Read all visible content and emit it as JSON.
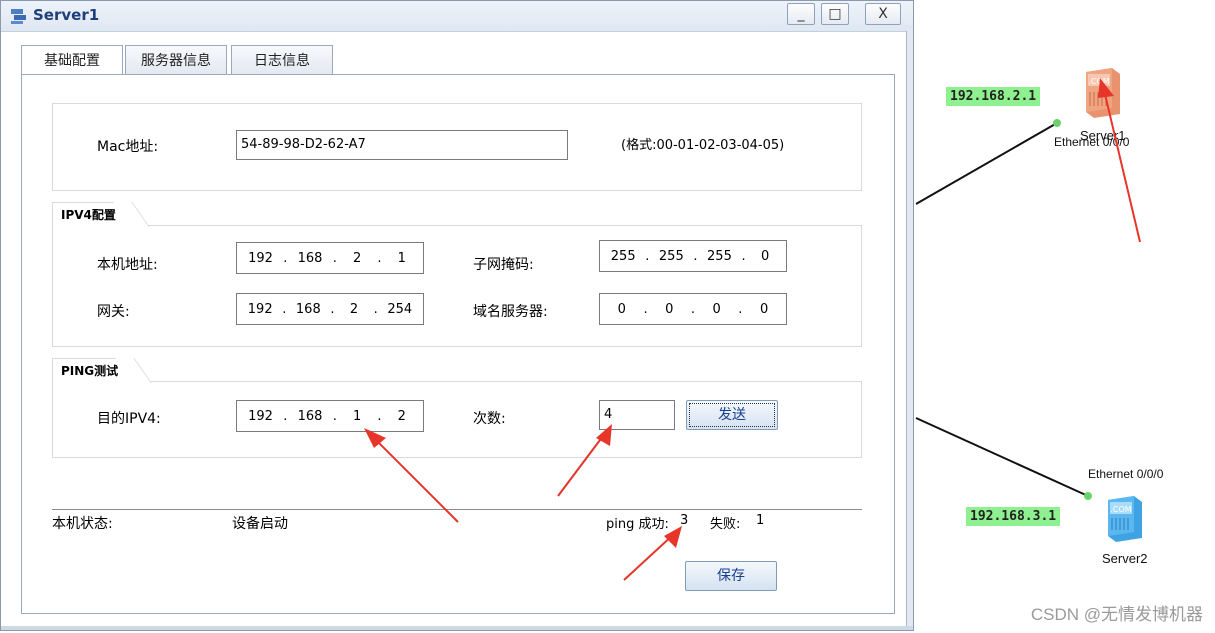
{
  "window": {
    "title": "Server1",
    "minimize": "_",
    "maximize": "□",
    "close": "X"
  },
  "tabs": [
    {
      "label": "基础配置"
    },
    {
      "label": "服务器信息"
    },
    {
      "label": "日志信息"
    }
  ],
  "mac": {
    "label": "Mac地址:",
    "value": "54-89-98-D2-62-A7",
    "hint": "(格式:00-01-02-03-04-05)"
  },
  "ipv4": {
    "section_title": "IPV4配置",
    "local_address_label": "本机地址:",
    "local_address": [
      "192",
      "168",
      "2",
      "1"
    ],
    "subnet_mask_label": "子网掩码:",
    "subnet_mask": [
      "255",
      "255",
      "255",
      "0"
    ],
    "gateway_label": "网关:",
    "gateway": [
      "192",
      "168",
      "2",
      "254"
    ],
    "dns_label": "域名服务器:",
    "dns": [
      "0",
      "0",
      "0",
      "0"
    ]
  },
  "ping": {
    "section_title": "PING测试",
    "dest_label": "目的IPV4:",
    "dest": [
      "192",
      "168",
      "1",
      "2"
    ],
    "count_label": "次数:",
    "count": "4",
    "send_button": "发送"
  },
  "status": {
    "label": "本机状态:",
    "value": "设备启动",
    "success_label": "ping 成功:",
    "success_count": "3",
    "fail_label": "失败:",
    "fail_count": "1"
  },
  "save_button": "保存",
  "topology": {
    "server1": {
      "name": "Server1",
      "ip": "192.168.2.1",
      "port": "Ethernet 0/0/0"
    },
    "server2": {
      "name": "Server2",
      "ip": "192.168.3.1",
      "port": "Ethernet 0/0/0"
    },
    "device_badge": ".COM"
  },
  "annotation_color": "#e8352a",
  "link_dot_color": "#6cd26c",
  "watermark": "CSDN @无情发博机器"
}
